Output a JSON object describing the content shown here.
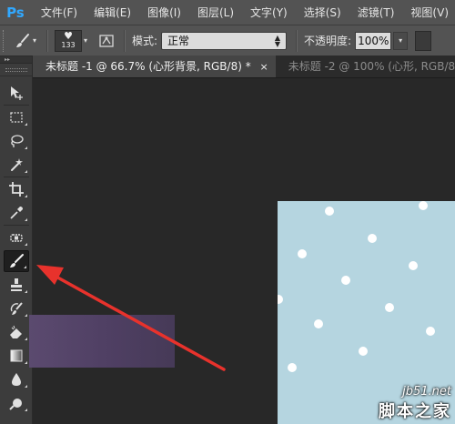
{
  "app": {
    "logo": "Ps",
    "menu": [
      "文件(F)",
      "编辑(E)",
      "图像(I)",
      "图层(L)",
      "文字(Y)",
      "选择(S)",
      "滤镜(T)",
      "视图(V)"
    ]
  },
  "options_bar": {
    "brush_size": "133",
    "mode_label": "模式:",
    "mode_value": "正常",
    "opacity_label": "不透明度:",
    "opacity_value": "100%"
  },
  "tools": [
    {
      "name": "move-tool",
      "icon": "move-icon"
    },
    {
      "name": "marquee-tool",
      "icon": "rect-marquee-icon"
    },
    {
      "name": "lasso-tool",
      "icon": "lasso-icon"
    },
    {
      "name": "magic-wand-tool",
      "icon": "magic-wand-icon"
    },
    {
      "name": "crop-tool",
      "icon": "crop-icon"
    },
    {
      "name": "eyedropper-tool",
      "icon": "eyedropper-icon"
    },
    {
      "name": "healing-brush-tool",
      "icon": "bandage-icon"
    },
    {
      "name": "brush-tool",
      "icon": "brush-icon",
      "active": true
    },
    {
      "name": "clone-stamp-tool",
      "icon": "stamp-icon"
    },
    {
      "name": "history-brush-tool",
      "icon": "history-brush-icon"
    },
    {
      "name": "eraser-tool",
      "icon": "eraser-icon"
    },
    {
      "name": "gradient-tool",
      "icon": "gradient-icon"
    },
    {
      "name": "blur-tool",
      "icon": "drop-icon"
    },
    {
      "name": "dodge-tool",
      "icon": "dodge-icon"
    }
  ],
  "tabs": [
    {
      "label": "未标题 -1 @ 66.7% (心形背景, RGB/8) *",
      "active": true
    },
    {
      "label": "未标题 -2 @ 100% (心形, RGB/8)",
      "active": false
    }
  ],
  "watermark": {
    "url": "jb51.net",
    "text": "脚本之家"
  },
  "colors": {
    "canvas": "#b5d5e0",
    "arrow": "#e8322c",
    "ps_blue": "#31a8ff"
  }
}
